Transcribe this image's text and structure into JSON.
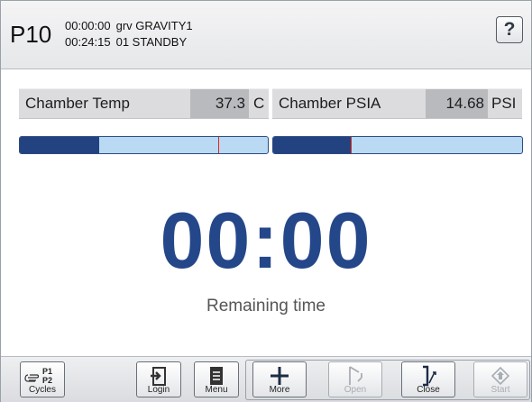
{
  "header": {
    "program": "P10",
    "time_elapsed": "00:00:00",
    "cycle_name": "grv GRAVITY1",
    "time_clock": "00:24:15",
    "status": "01 STANDBY",
    "help_label": "?"
  },
  "readouts": {
    "temp": {
      "label": "Chamber Temp",
      "value": "37.3",
      "unit": "C"
    },
    "psia": {
      "label": "Chamber PSIA",
      "value": "14.68",
      "unit": "PSI"
    }
  },
  "bars": {
    "temp": {
      "fill_fraction": 0.32,
      "marker_fraction": 0.8,
      "fill_color": "#22437f",
      "track_color": "#b9daf2",
      "marker_color": "#e2261c"
    },
    "psia": {
      "fill_fraction": 0.31,
      "marker_fraction": 0.31,
      "fill_color": "#22437f",
      "track_color": "#b9daf2",
      "marker_color": "#e2261c"
    }
  },
  "timer": {
    "value": "00:00",
    "label": "Remaining time",
    "color": "#24478a"
  },
  "toolbar": {
    "cycles": {
      "label": "Cycles",
      "p1": "P1",
      "p2": "P2",
      "icon": "hand-pointer-icon"
    },
    "login": {
      "label": "Login",
      "icon": "login-icon"
    },
    "menu": {
      "label": "Menu",
      "icon": "menu-icon"
    },
    "more": {
      "label": "More",
      "icon": "plus-icon"
    },
    "open": {
      "label": "Open",
      "icon": "door-open-icon",
      "enabled": false
    },
    "close": {
      "label": "Close",
      "icon": "door-close-icon"
    },
    "start": {
      "label": "Start",
      "icon": "start-diamond-icon",
      "enabled": false
    }
  }
}
